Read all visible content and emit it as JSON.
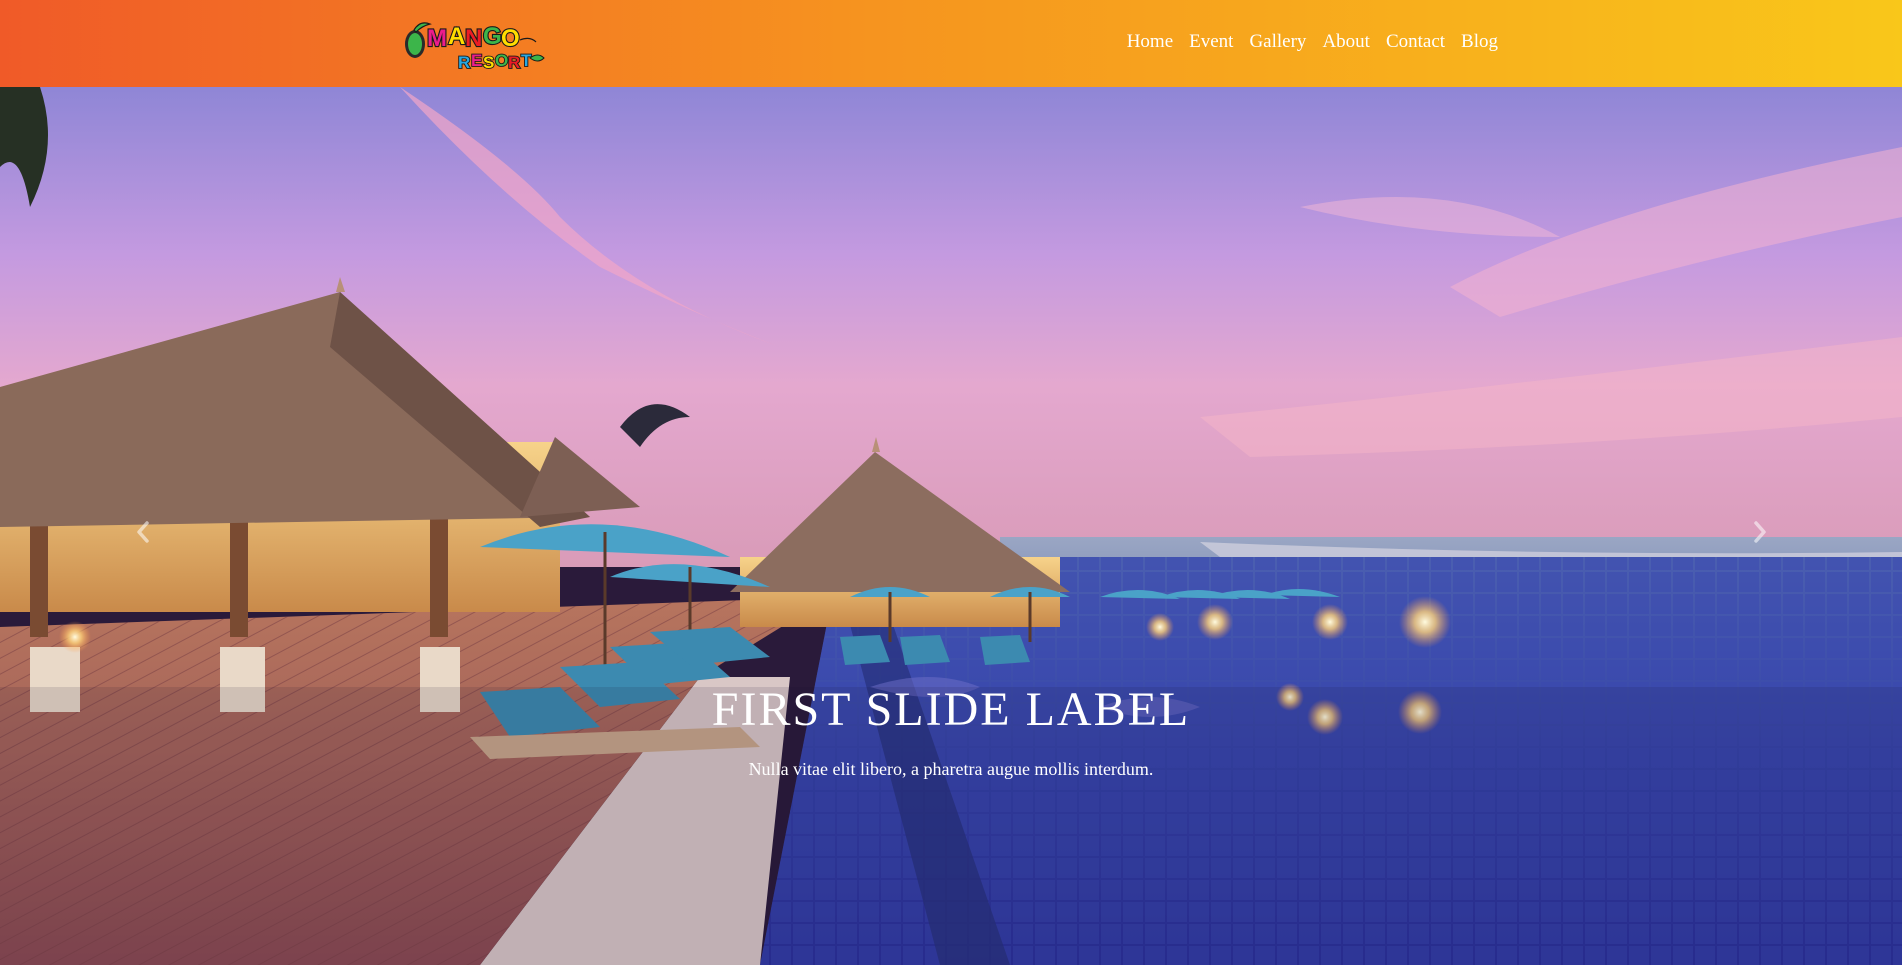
{
  "brand": {
    "logo_alt": "Mango Resort logo",
    "logo_line1": "MANGO",
    "logo_line2": "RESORT"
  },
  "nav": {
    "items": [
      {
        "label": "Home"
      },
      {
        "label": "Event"
      },
      {
        "label": "Gallery"
      },
      {
        "label": "About"
      },
      {
        "label": "Contact"
      },
      {
        "label": "Blog"
      }
    ]
  },
  "hero": {
    "image_alt": "Resort pool deck with thatched huts at sunset",
    "slide_title": "FIRST SLIDE LABEL",
    "slide_text": "Nulla vitae elit libero, a pharetra augue mollis interdum.",
    "prev_icon": "chevron-left-icon",
    "next_icon": "chevron-right-icon"
  },
  "colors": {
    "nav_gradient_start": "#f05a28",
    "nav_gradient_mid": "#f6931f",
    "nav_gradient_end": "#f9c71a",
    "text": "#ffffff"
  }
}
